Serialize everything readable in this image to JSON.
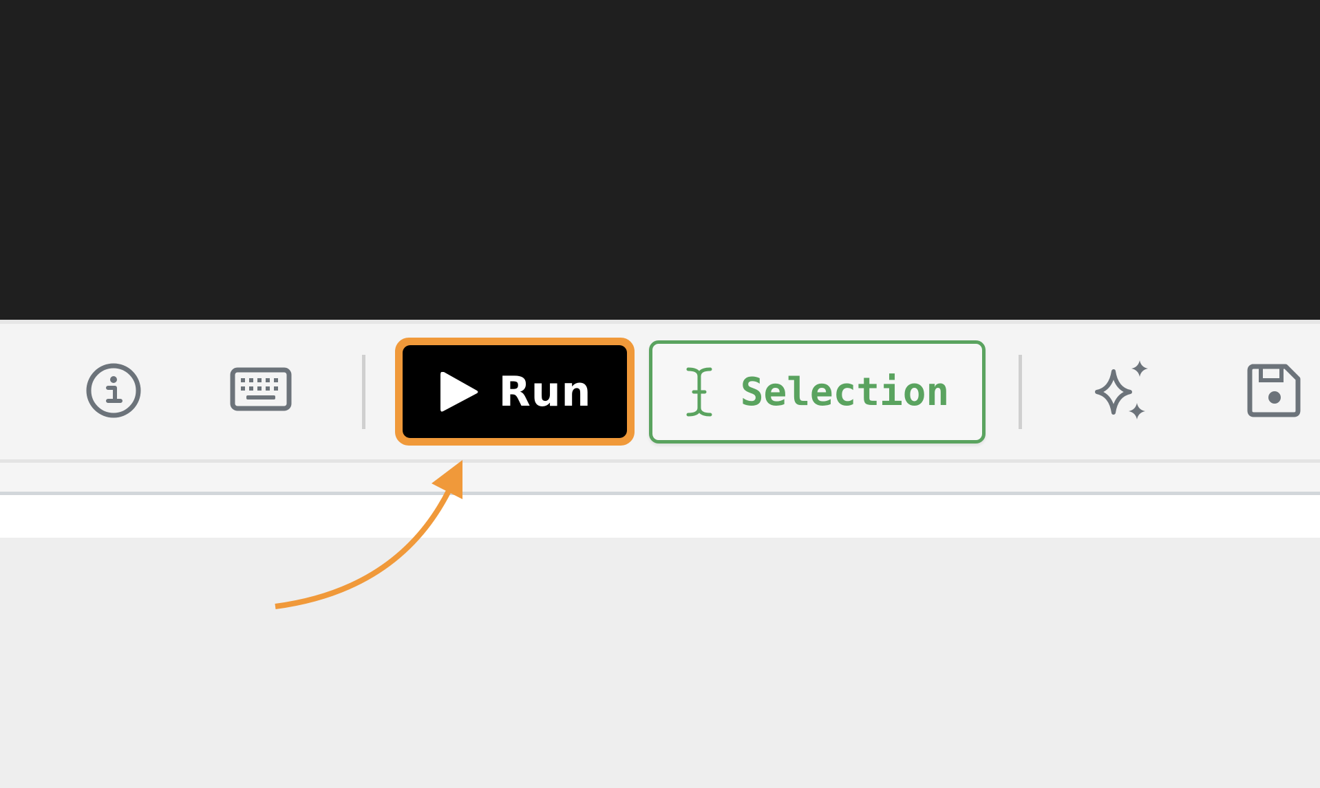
{
  "toolbar": {
    "info_icon": "info-icon",
    "keyboard_icon": "keyboard-icon",
    "run_label": "Run",
    "run_icon": "play-icon",
    "selection_label": "Selection",
    "selection_icon": "text-cursor-icon",
    "sparkle_icon": "sparkle-icon",
    "save_icon": "save-icon"
  },
  "colors": {
    "editor_background": "#1f1f1f",
    "toolbar_background": "#f4f4f4",
    "run_button_background": "#000000",
    "run_highlight": "#f0993a",
    "selection_accent": "#5aa35f",
    "icon_gray": "#6c737a",
    "annotation_arrow": "#f0993a"
  },
  "annotation": {
    "type": "arrow",
    "target": "run-button"
  }
}
